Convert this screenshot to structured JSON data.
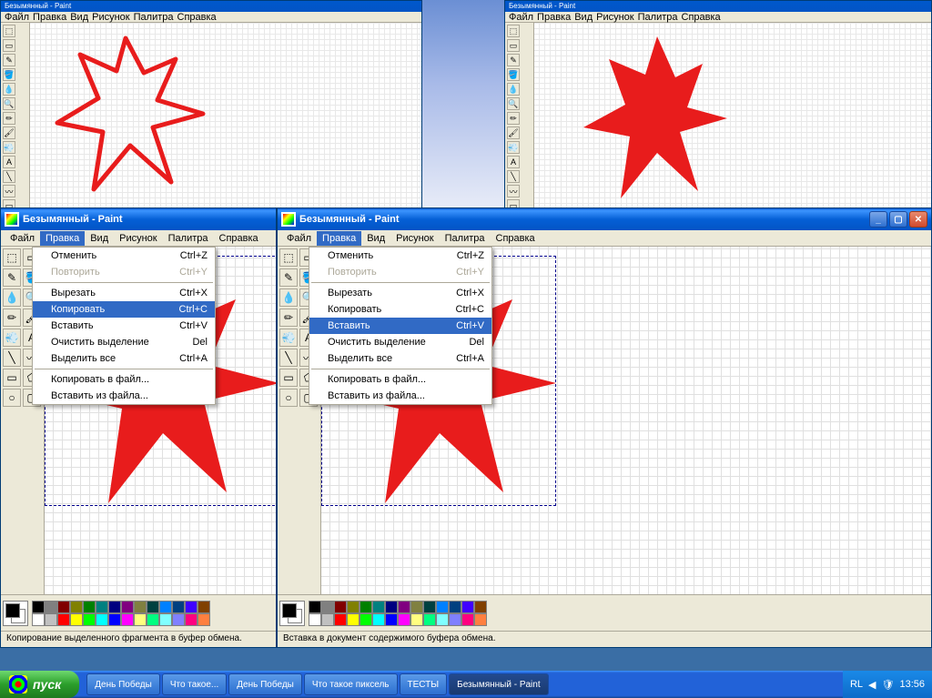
{
  "app_title": "Безымянный - Paint",
  "menus": [
    "Файл",
    "Правка",
    "Вид",
    "Рисунок",
    "Палитра",
    "Справка"
  ],
  "edit_menu": [
    {
      "label": "Отменить",
      "shortcut": "Ctrl+Z",
      "dis": false
    },
    {
      "label": "Повторить",
      "shortcut": "Ctrl+Y",
      "dis": true
    },
    {
      "sep": true
    },
    {
      "label": "Вырезать",
      "shortcut": "Ctrl+X",
      "dis": false
    },
    {
      "label": "Копировать",
      "shortcut": "Ctrl+C",
      "dis": false
    },
    {
      "label": "Вставить",
      "shortcut": "Ctrl+V",
      "dis": false
    },
    {
      "label": "Очистить выделение",
      "shortcut": "Del",
      "dis": false
    },
    {
      "label": "Выделить все",
      "shortcut": "Ctrl+A",
      "dis": false
    },
    {
      "sep": true
    },
    {
      "label": "Копировать в файл...",
      "shortcut": "",
      "dis": false
    },
    {
      "label": "Вставить из файла...",
      "shortcut": "",
      "dis": false
    }
  ],
  "highlight_q3": "Копировать",
  "highlight_q4": "Вставить",
  "status_q3": "Копирование выделенного фрагмента в буфер обмена.",
  "status_q4": "Вставка в документ содержимого буфера обмена.",
  "palette_colors": [
    "#000000",
    "#808080",
    "#800000",
    "#808000",
    "#008000",
    "#008080",
    "#000080",
    "#800080",
    "#808040",
    "#004040",
    "#0080ff",
    "#004080",
    "#4000ff",
    "#804000",
    "#ffffff",
    "#c0c0c0",
    "#ff0000",
    "#ffff00",
    "#00ff00",
    "#00ffff",
    "#0000ff",
    "#ff00ff",
    "#ffff80",
    "#00ff80",
    "#80ffff",
    "#8080ff",
    "#ff0080",
    "#ff8040"
  ],
  "tools": [
    "⬚",
    "▭",
    "✎",
    "🪣",
    "💧",
    "🔍",
    "✏",
    "🖌",
    "💨",
    "A",
    "╲",
    "〰",
    "▭",
    "⬠",
    "○",
    "▢"
  ],
  "taskbar": {
    "start": "пуск",
    "buttons": [
      "День Победы",
      "Что такое...",
      "День Победы",
      "Что такое пиксель",
      "ТЕСТЫ",
      "Безымянный - Paint"
    ],
    "lang": "RL",
    "time": "13:56"
  }
}
